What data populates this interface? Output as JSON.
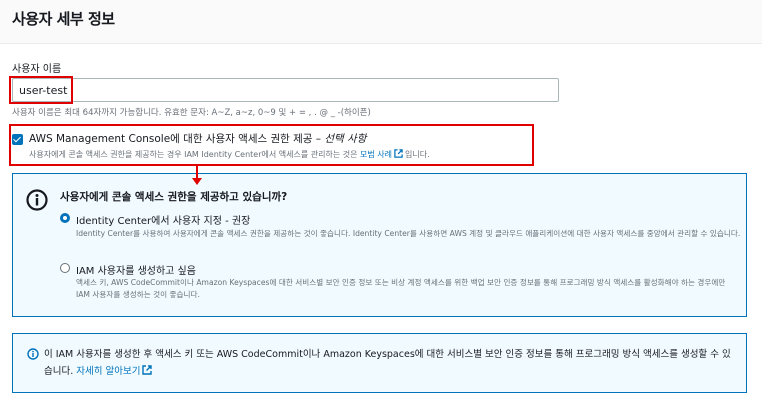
{
  "header": {
    "title": "사용자 세부 정보"
  },
  "username": {
    "label": "사용자 이름",
    "value": "user-test",
    "hint": "사용자 이름은 최대 64자까지 가능합니다. 유효한 문자: A~Z, a~z, 0~9 및 + = , . @ _ -(하이픈)"
  },
  "console_access": {
    "checked": true,
    "label": "AWS Management Console에 대한 사용자 액세스 권한 제공 – ",
    "optional": "선택 사항",
    "desc_before": "사용자에게 콘솔 액세스 권한을 제공하는 경우 IAM Identity Center에서 액세스를 관리하는 것은 ",
    "desc_link": "모범 사례",
    "desc_after": "입니다."
  },
  "question": {
    "title": "사용자에게 콘솔 액세스 권한을 제공하고 있습니까?",
    "options": [
      {
        "title": "Identity Center에서 사용자 지정 - 권장",
        "desc": "Identity Center를 사용하여 사용자에게 콘솔 액세스 권한을 제공하는 것이 좋습니다. Identity Center를 사용하면 AWS 계정 및 클라우드 애플리케이션에 대한 사용자 액세스를 중앙에서 관리할 수 있습니다.",
        "selected": true
      },
      {
        "title": "IAM 사용자를 생성하고 싶음",
        "desc": "액세스 키, AWS CodeCommit이나 Amazon Keyspaces에 대한 서비스별 보안 인증 정보 또는 비상 계정 액세스를 위한 백업 보안 인증 정보를 통해 프로그래밍 방식 액세스를 활성화해야 하는 경우에만 IAM 사용자를 생성하는 것이 좋습니다.",
        "selected": false
      }
    ]
  },
  "note": {
    "text": "이 IAM 사용자를 생성한 후 액세스 키 또는 AWS CodeCommit이나 Amazon Keyspaces에 대한 서비스별 보안 인증 정보를 통해 프로그래밍 방식 액세스를 생성할 수 있습니다. ",
    "link": "자세히 알아보기"
  },
  "colors": {
    "accent": "#0073bb",
    "highlight": "#e00000",
    "panel_bg": "#f1faff"
  },
  "icons": {
    "info": "info-icon",
    "external": "external-link-icon",
    "check": "check-icon"
  }
}
